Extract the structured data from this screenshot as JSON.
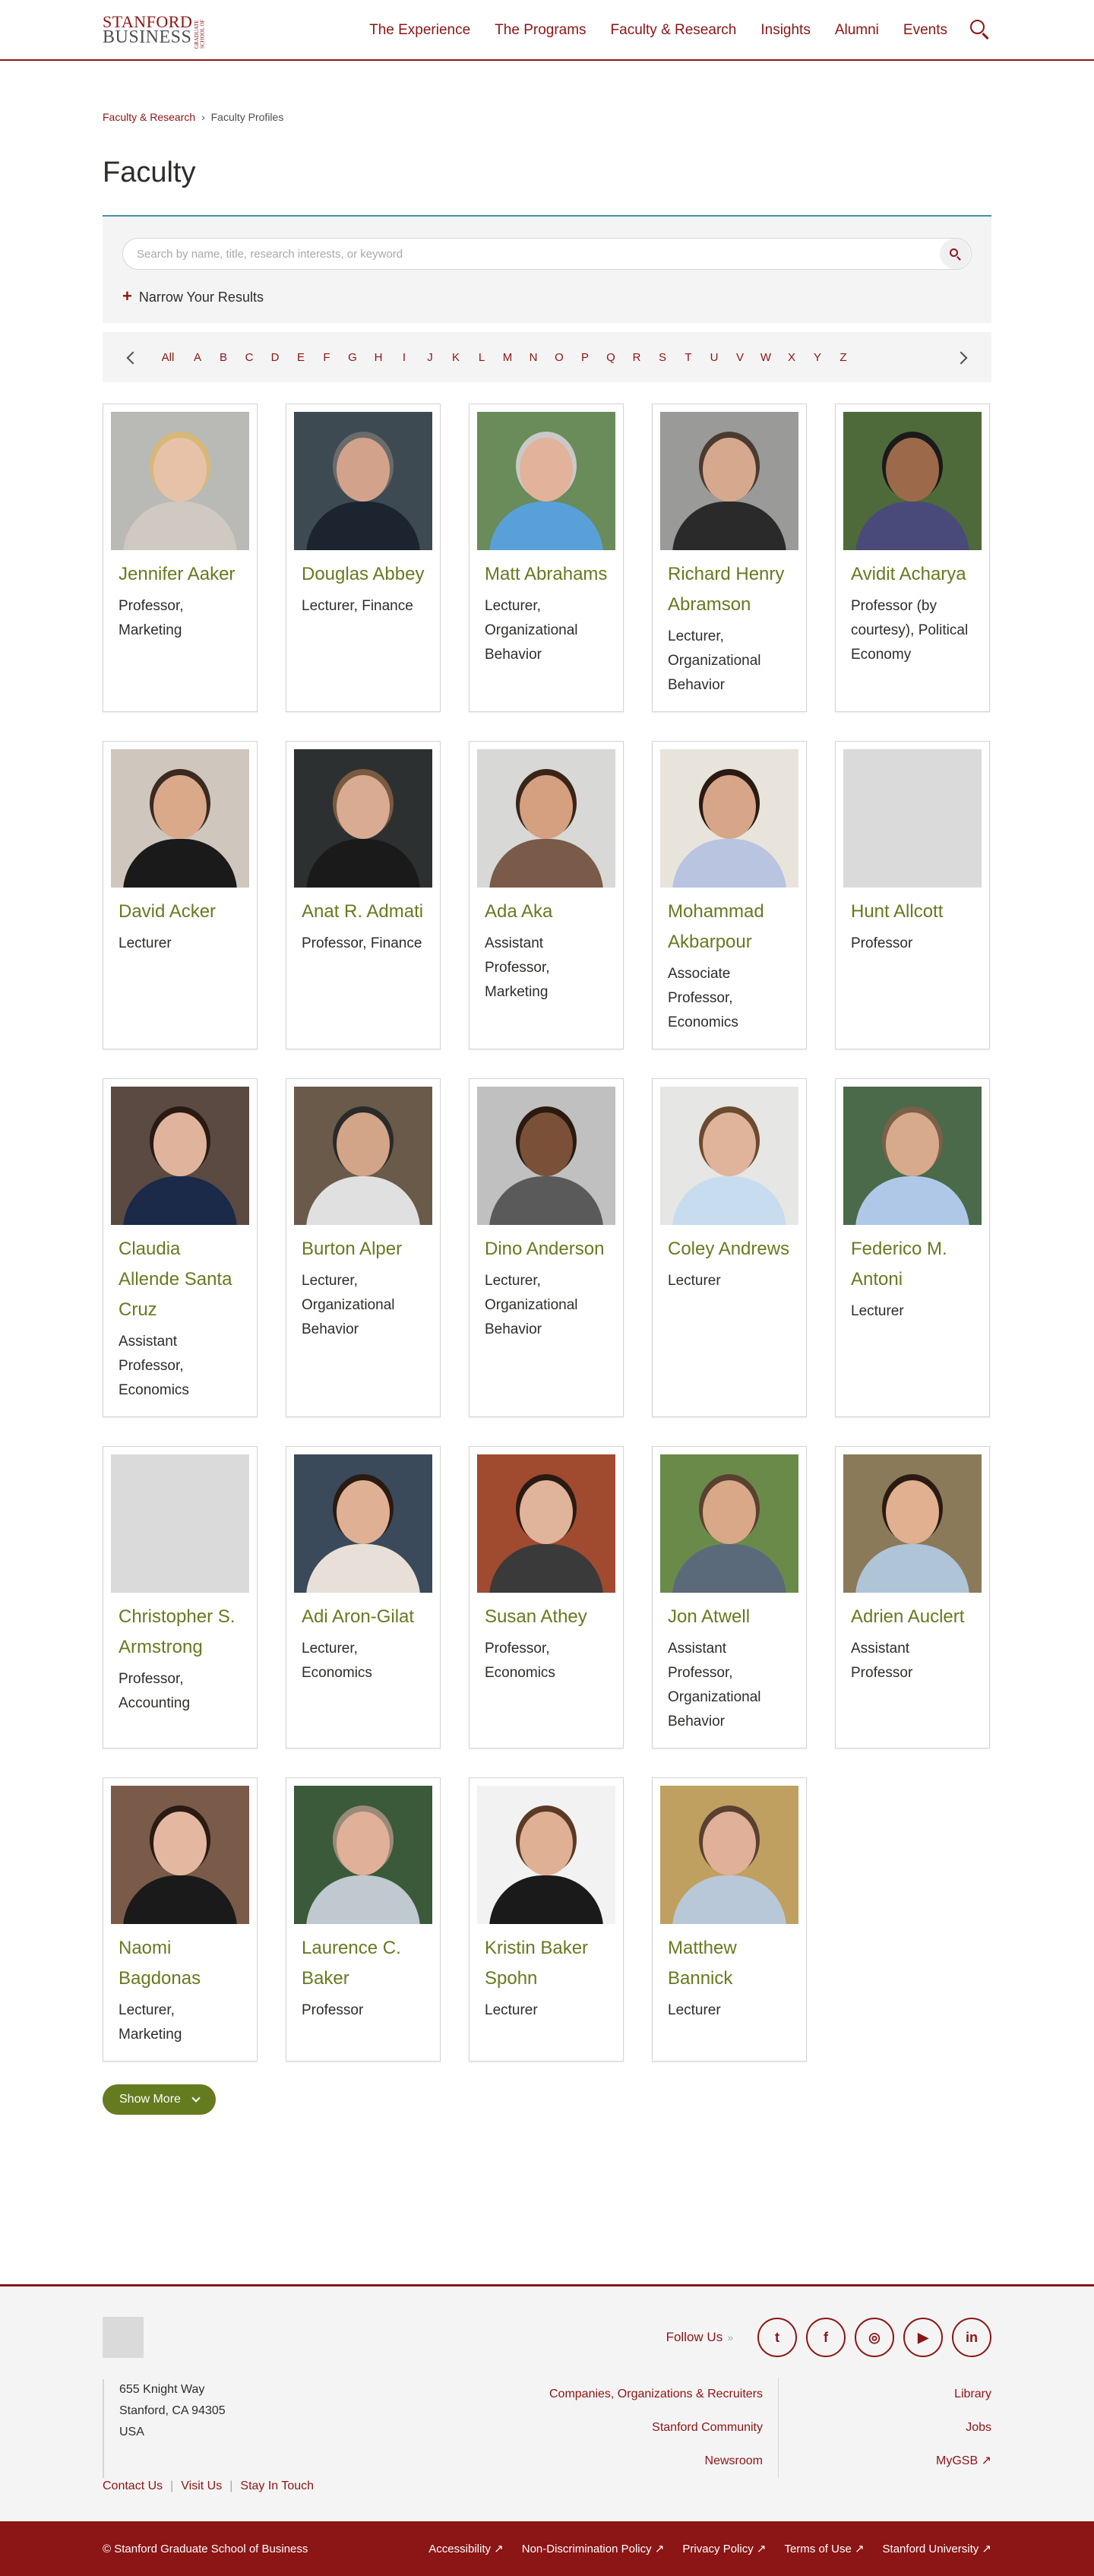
{
  "header": {
    "logo_line1": "STANFORD",
    "logo_line2": "BUSINESS",
    "logo_side": "GRADUATE SCHOOL OF",
    "nav": [
      "The Experience",
      "The Programs",
      "Faculty & Research",
      "Insights",
      "Alumni",
      "Events"
    ],
    "search_icon": "search-icon"
  },
  "breadcrumb": {
    "parent": "Faculty & Research",
    "separator": "›",
    "current": "Faculty Profiles"
  },
  "page_title": "Faculty",
  "search": {
    "placeholder": "Search by name, title, research interests, or keyword",
    "narrow_label": "Narrow Your Results",
    "narrow_icon": "+"
  },
  "alphabet": [
    "All",
    "A",
    "B",
    "C",
    "D",
    "E",
    "F",
    "G",
    "H",
    "I",
    "J",
    "K",
    "L",
    "M",
    "N",
    "O",
    "P",
    "Q",
    "R",
    "S",
    "T",
    "U",
    "V",
    "W",
    "X",
    "Y",
    "Z"
  ],
  "faculty": [
    {
      "name": "Jennifer Aaker",
      "title": "Professor, Marketing",
      "photo": {
        "bg": "#b9b9b5",
        "skin": "#e8c2a8",
        "hair": "#d8b878",
        "shirt": "#cfc9c2"
      }
    },
    {
      "name": "Douglas Abbey",
      "title": "Lecturer, Finance",
      "photo": {
        "bg": "#3d4a52",
        "skin": "#d2a38a",
        "hair": "#6b6b6b",
        "shirt": "#1c2430"
      }
    },
    {
      "name": "Matt Abrahams",
      "title": "Lecturer, Organizational Behavior",
      "photo": {
        "bg": "#6a8b5a",
        "skin": "#e2b29a",
        "hair": "#c9c9c9",
        "shirt": "#5aa0d8"
      }
    },
    {
      "name": "Richard Henry Abramson",
      "title": "Lecturer, Organizational Behavior",
      "photo": {
        "bg": "#9a9a98",
        "skin": "#d6a88e",
        "hair": "#4a3a30",
        "shirt": "#2a2a2a"
      }
    },
    {
      "name": "Avidit Acharya",
      "title": "Professor (by courtesy), Political Economy",
      "photo": {
        "bg": "#4e6a3a",
        "skin": "#9c6a4a",
        "hair": "#1a1a1a",
        "shirt": "#4a4a7a"
      }
    },
    {
      "name": "David Acker",
      "title": "Lecturer",
      "photo": {
        "bg": "#cfc7bd",
        "skin": "#d9a98a",
        "hair": "#3a2a20",
        "shirt": "#1a1a1a"
      }
    },
    {
      "name": "Anat R. Admati",
      "title": "Professor, Finance",
      "photo": {
        "bg": "#2d3030",
        "skin": "#d9ab93",
        "hair": "#7a5a40",
        "shirt": "#1a1a1a"
      }
    },
    {
      "name": "Ada Aka",
      "title": "Assistant Professor, Marketing",
      "photo": {
        "bg": "#d8d8d6",
        "skin": "#d4a080",
        "hair": "#3a2418",
        "shirt": "#7a5a48"
      }
    },
    {
      "name": "Mohammad Akbarpour",
      "title": "Associate Professor, Economics",
      "photo": {
        "bg": "#e8e4dc",
        "skin": "#d7a688",
        "hair": "#2a1a12",
        "shirt": "#b8c4e0"
      }
    },
    {
      "name": "Hunt Allcott",
      "title": "Professor",
      "photo": null
    },
    {
      "name": "Claudia Allende Santa Cruz",
      "title": "Assistant Professor, Economics",
      "photo": {
        "bg": "#5a4a42",
        "skin": "#e0b49c",
        "hair": "#2a1a14",
        "shirt": "#1a2a48"
      }
    },
    {
      "name": "Burton Alper",
      "title": "Lecturer, Organizational Behavior",
      "photo": {
        "bg": "#6a5a4a",
        "skin": "#d2a488",
        "hair": "#2a2a2a",
        "shirt": "#e0e0e0"
      }
    },
    {
      "name": "Dino Anderson",
      "title": "Lecturer, Organizational Behavior",
      "photo": {
        "bg": "#c0c0c0",
        "skin": "#7a5038",
        "hair": "#2a1a10",
        "shirt": "#5a5a5a"
      }
    },
    {
      "name": "Coley Andrews",
      "title": "Lecturer",
      "photo": {
        "bg": "#e6e6e4",
        "skin": "#e0b49a",
        "hair": "#6a4a30",
        "shirt": "#c8dcf0"
      }
    },
    {
      "name": "Federico M. Antoni",
      "title": "Lecturer",
      "photo": {
        "bg": "#4a6a4a",
        "skin": "#d8aa8c",
        "hair": "#7a6048",
        "shirt": "#b0c8e8"
      }
    },
    {
      "name": "Christopher S. Armstrong",
      "title": "Professor, Accounting",
      "photo": null
    },
    {
      "name": "Adi Aron-Gilat",
      "title": "Lecturer, Economics",
      "photo": {
        "bg": "#3a4a5a",
        "skin": "#e0b094",
        "hair": "#2a1a12",
        "shirt": "#e8e0d8"
      }
    },
    {
      "name": "Susan Athey",
      "title": "Professor, Economics",
      "photo": {
        "bg": "#a04a30",
        "skin": "#e0b49a",
        "hair": "#2a1a12",
        "shirt": "#3a3a3a"
      }
    },
    {
      "name": "Jon Atwell",
      "title": "Assistant Professor, Organizational Behavior",
      "photo": {
        "bg": "#6a8a4a",
        "skin": "#d8a888",
        "hair": "#5a4030",
        "shirt": "#5a6a7a"
      }
    },
    {
      "name": "Adrien Auclert",
      "title": "Assistant Professor",
      "photo": {
        "bg": "#8a7a5a",
        "skin": "#e0b090",
        "hair": "#2a1a10",
        "shirt": "#b0c4d8"
      }
    },
    {
      "name": "Naomi Bagdonas",
      "title": "Lecturer, Marketing",
      "photo": {
        "bg": "#7a5a48",
        "skin": "#e4b8a0",
        "hair": "#2a1a14",
        "shirt": "#1a1a1a"
      }
    },
    {
      "name": "Laurence C. Baker",
      "title": "Professor",
      "photo": {
        "bg": "#3a5a3a",
        "skin": "#e0b098",
        "hair": "#9a8a78",
        "shirt": "#c0c8d0"
      }
    },
    {
      "name": "Kristin Baker Spohn",
      "title": "Lecturer",
      "photo": {
        "bg": "#f2f2f2",
        "skin": "#e0b094",
        "hair": "#5a3a24",
        "shirt": "#1a1a1a"
      }
    },
    {
      "name": "Matthew Bannick",
      "title": "Lecturer",
      "photo": {
        "bg": "#c0a060",
        "skin": "#e0b098",
        "hair": "#5a4030",
        "shirt": "#b8c8d8"
      }
    }
  ],
  "show_more": "Show More",
  "footer": {
    "follow_label": "Follow Us",
    "follow_arrows": "»",
    "social": [
      {
        "icon": "twitter-icon",
        "glyph": "t"
      },
      {
        "icon": "facebook-icon",
        "glyph": "f"
      },
      {
        "icon": "instagram-icon",
        "glyph": "◎"
      },
      {
        "icon": "youtube-icon",
        "glyph": "▶"
      },
      {
        "icon": "linkedin-icon",
        "glyph": "in"
      }
    ],
    "address": [
      "655 Knight Way",
      "Stanford, CA 94305",
      "USA"
    ],
    "links_col1": [
      "Companies, Organizations & Recruiters",
      "Stanford Community",
      "Newsroom"
    ],
    "links_col2": [
      "Library",
      "Jobs",
      "MyGSB ↗"
    ],
    "bottom_links": [
      "Contact Us",
      "Visit Us",
      "Stay In Touch"
    ]
  },
  "legal": {
    "copyright": "© Stanford Graduate School of Business",
    "links": [
      "Accessibility ↗",
      "Non-Discrimination Policy ↗",
      "Privacy Policy ↗",
      "Terms of Use ↗",
      "Stanford University ↗"
    ]
  }
}
